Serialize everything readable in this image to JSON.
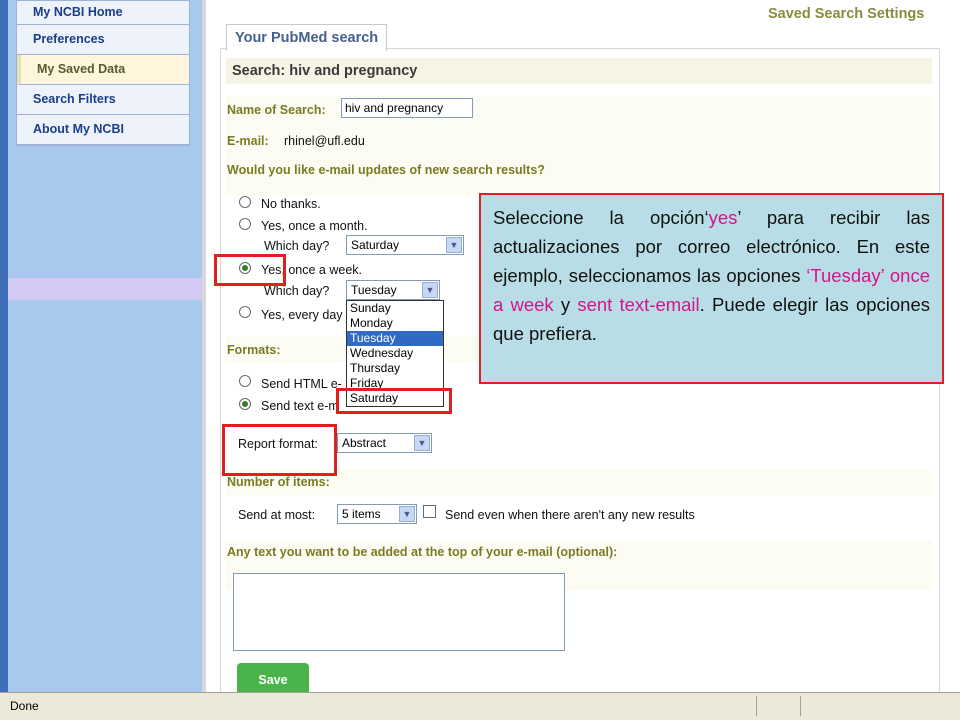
{
  "sidebar": {
    "items": [
      {
        "label": "My NCBI Home"
      },
      {
        "label": "Preferences"
      },
      {
        "label": "My Saved Data"
      },
      {
        "label": "Search Filters"
      },
      {
        "label": "About My NCBI"
      }
    ]
  },
  "header": {
    "page_title": "Saved Search Settings",
    "tab_label": "Your PubMed search",
    "search_heading": "Search: hiv and pregnancy"
  },
  "form": {
    "name_label": "Name of Search:",
    "name_value": "hiv and pregnancy",
    "email_label": "E-mail:",
    "email_value": "rhinel@ufl.edu",
    "updates_question": "Would you like e-mail updates of new search results?",
    "option_no": "No thanks.",
    "option_month": "Yes, once a month.",
    "which_day_label": "Which day?",
    "month_day_value": "Saturday",
    "option_week": "Yes, once a week.",
    "week_day_value": "Tuesday",
    "option_every_day": "Yes, every day",
    "day_options": [
      "Sunday",
      "Monday",
      "Tuesday",
      "Wednesday",
      "Thursday",
      "Friday",
      "Saturday"
    ],
    "formats_label": "Formats:",
    "format_html": "Send HTML e-",
    "format_text": "Send text e-m",
    "report_format_label": "Report format:",
    "report_format_value": "Abstract",
    "items_label": "Number of items:",
    "send_at_most_label": "Send at most:",
    "items_value": "5 items",
    "send_even_label": "Send even when there aren't any new results",
    "text_label": "Any text you want to be added at the top of your e-mail (optional):",
    "save_label": "Save"
  },
  "callout": {
    "part1": "Seleccione la opción‘",
    "hl1": "yes",
    "part2": "’ para recibir las actualizaciones por correo electrónico. En este ejemplo, seleccionamos las opciones ",
    "hl2": "‘Tuesday’ once a week",
    "part3": " y ",
    "hl3": "sent text-email",
    "part4": ". Puede elegir las opciones que prefiera."
  },
  "status": {
    "text": "Done"
  }
}
